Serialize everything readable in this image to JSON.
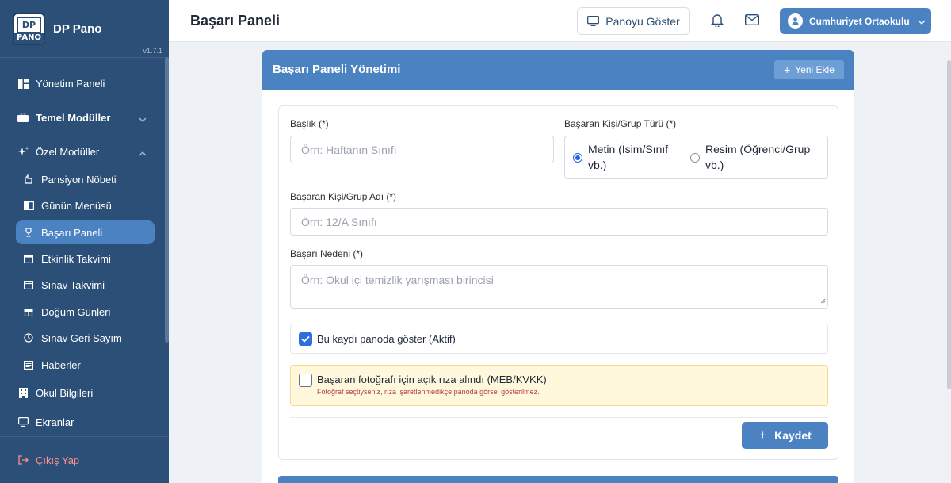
{
  "brand": {
    "name": "DP Pano",
    "logo_top": "DP",
    "logo_bottom": "PANO",
    "version": "v1.7.1"
  },
  "sidebar": {
    "items": [
      {
        "label": "Yönetim Paneli",
        "icon": "dashboard-icon"
      },
      {
        "label": "Temel Modüller",
        "icon": "briefcase-icon"
      },
      {
        "label": "Özel Modüller",
        "icon": "sparkle-icon"
      },
      {
        "label": "Pansiyon Nöbeti",
        "icon": "hand-icon"
      },
      {
        "label": "Günün Menüsü",
        "icon": "book-icon"
      },
      {
        "label": "Başarı Paneli",
        "icon": "trophy-icon"
      },
      {
        "label": "Etkinlik Takvimi",
        "icon": "calendar-icon"
      },
      {
        "label": "Sınav Takvimi",
        "icon": "calendar-check-icon"
      },
      {
        "label": "Doğum Günleri",
        "icon": "gift-icon"
      },
      {
        "label": "Sınav Geri Sayım",
        "icon": "clock-icon"
      },
      {
        "label": "Haberler",
        "icon": "newspaper-icon"
      },
      {
        "label": "Okul Bilgileri",
        "icon": "building-icon"
      },
      {
        "label": "Ekranlar",
        "icon": "monitor-icon"
      }
    ],
    "logout": "Çıkış Yap",
    "active": "Başarı Paneli"
  },
  "header": {
    "title": "Başarı Paneli",
    "show_button": "Panoyu Göster",
    "user": "Cumhuriyet Ortaokulu"
  },
  "card": {
    "title": "Başarı Paneli Yönetimi",
    "add_button": "Yeni Ekle"
  },
  "form": {
    "title_label": "Başlık (*)",
    "title_placeholder": "Örn: Haftanın Sınıfı",
    "type_label": "Başaran Kişi/Grup Türü (*)",
    "type_options": [
      {
        "label_line1": "Metin (İsim/Sınıf",
        "label_line2": "vb.)",
        "selected": true
      },
      {
        "label_line1": "Resim (Öğrenci/Grup",
        "label_line2": "vb.)",
        "selected": false
      }
    ],
    "name_label": "Başaran Kişi/Grup Adı (*)",
    "name_placeholder": "Örn: 12/A Sınıfı",
    "reason_label": "Başarı Nedeni (*)",
    "reason_placeholder": "Örn: Okul içi temizlik yarışması birincisi",
    "active_checkbox": {
      "label": "Bu kaydı panoda göster (Aktif)",
      "checked": true
    },
    "consent_checkbox": {
      "label": "Başaran fotoğrafı için açık rıza alındı (MEB/KVKK)",
      "hint": "Fotoğraf seçtiyseniz, rıza işaretlenmedikçe panoda görsel gösterilmez.",
      "checked": false
    },
    "save_button": "Kaydet"
  },
  "colors": {
    "sidebar": "#2b4f76",
    "accent": "#4a82c2",
    "consent_bg": "#fff8dc"
  }
}
